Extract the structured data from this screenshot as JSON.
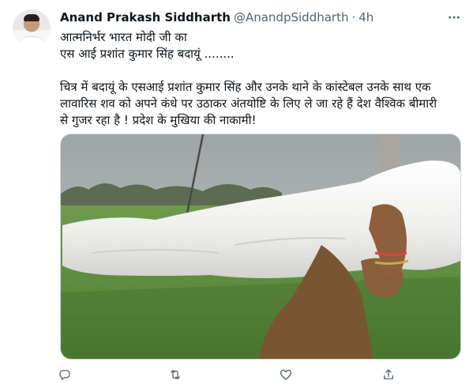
{
  "author": {
    "name": "Anand Prakash Siddharth",
    "handle": "@AnandpSiddharth",
    "separator": "·",
    "time": "4h"
  },
  "tweet": {
    "lines": [
      "आत्मनिर्भर भारत मोदी जी का",
      "एस आई प्रशांत कुमार सिंह बदायूं ........",
      "चित्र में बदायूं के एसआई प्रशांत कुमार सिंह और उनके थाने के कांस्टेबल उनके साथ एक",
      "लावारिस शव को अपने कंधे पर उठाकर अंतयोष्टि के लिए ले जा रहे हैं देश वैश्विक बीमारी",
      "से गुजर रहा है ! प्रदेश के मुखिया की नाकामी!"
    ]
  },
  "icons": {
    "more": "more-options-icon",
    "reply": "reply-icon",
    "retweet": "retweet-icon",
    "like": "like-icon",
    "share": "share-icon"
  },
  "colors": {
    "text": "#0f1419",
    "secondary": "#536471",
    "border": "#cfd9de"
  }
}
